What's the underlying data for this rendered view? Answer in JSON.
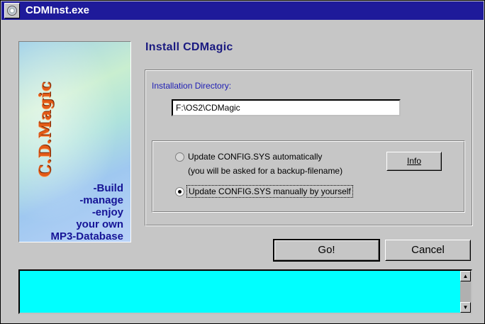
{
  "window": {
    "title": "CDMInst.exe"
  },
  "banner": {
    "logo_text": "C.D.Magic",
    "tagline": [
      "-Build",
      "-manage",
      "-enjoy",
      "your own",
      "MP3-Database"
    ]
  },
  "main": {
    "heading": "Install CDMagic",
    "directory_label": "Installation Directory:",
    "directory_value": "F:\\OS2\\CDMagic",
    "options": {
      "auto_line1": "Update CONFIG.SYS automatically",
      "auto_line2": "(you will be asked for a backup-filename)",
      "manual_label": "Update CONFIG.SYS manually by yourself",
      "selected": "manual"
    },
    "info_button": "Info",
    "go_button": "Go!",
    "cancel_button": "Cancel"
  },
  "log": {
    "text": ""
  },
  "colors": {
    "titlebar": "#1e1a9a",
    "log_background": "#00ffff",
    "accent_text": "#1e1eb4"
  },
  "icons": {
    "system_menu": "cd-disc-icon",
    "scroll_up": "arrow-up-icon",
    "scroll_down": "arrow-down-icon"
  }
}
